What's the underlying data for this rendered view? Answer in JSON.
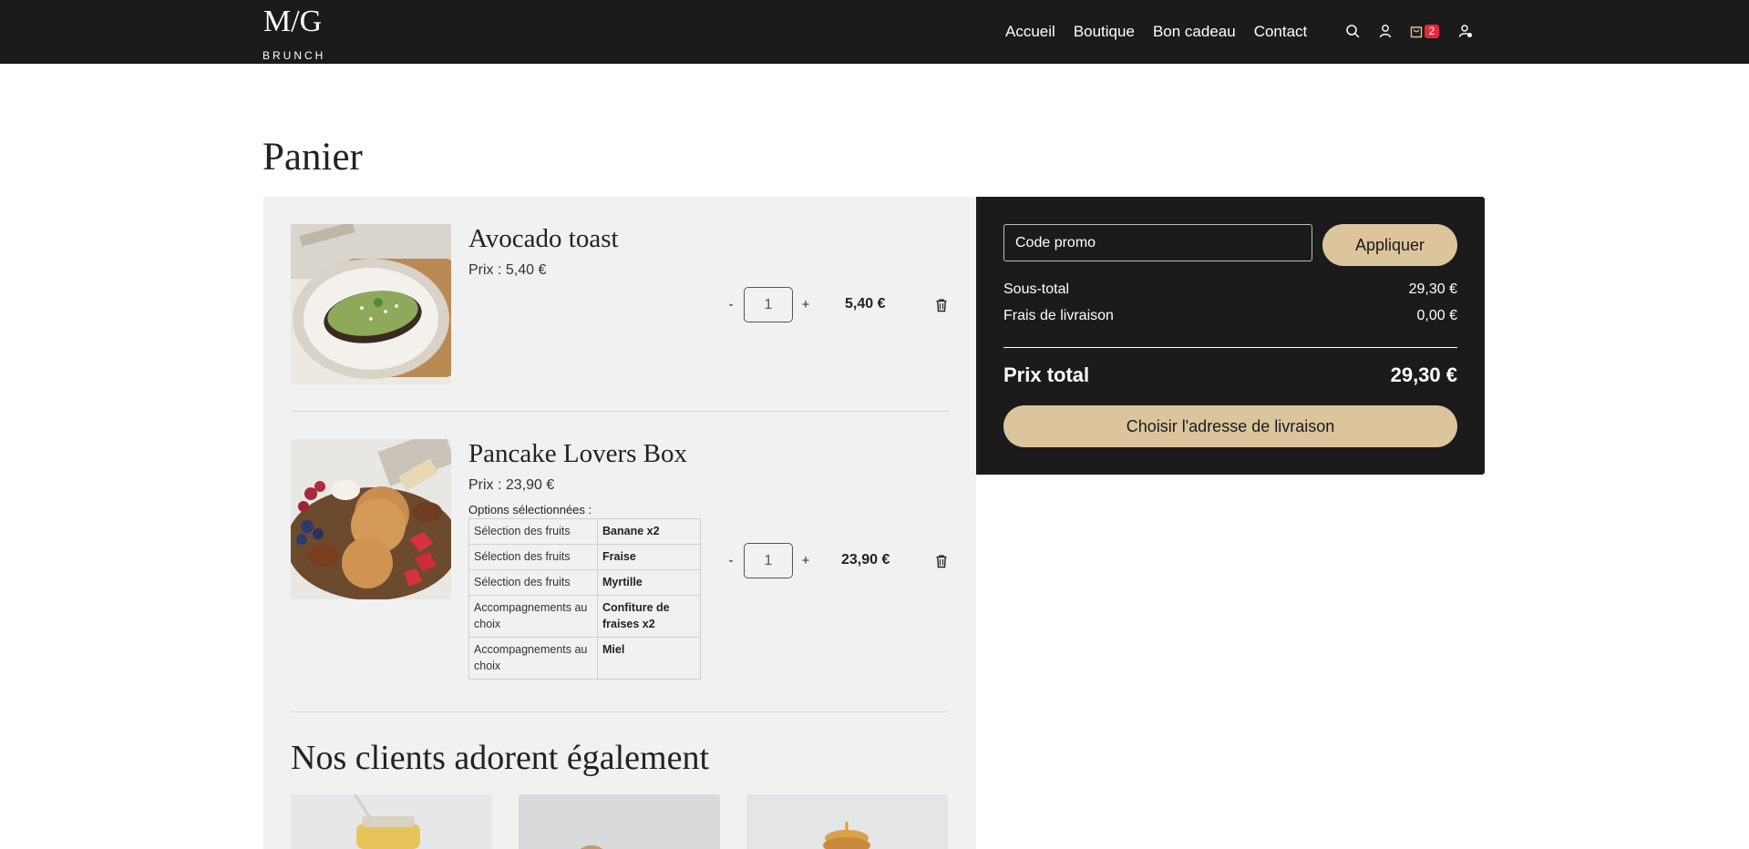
{
  "header": {
    "logo_mark": "M/G",
    "logo_word": "BRUNCH",
    "menu": [
      "Accueil",
      "Boutique",
      "Bon cadeau",
      "Contact"
    ],
    "icons": [
      "search-icon",
      "user-icon",
      "cart-icon",
      "account-icon"
    ],
    "cart_count": "2"
  },
  "page": {
    "title": "Panier"
  },
  "cart": {
    "items": [
      {
        "name": "Avocado toast",
        "price": "Prix : 5,40 €",
        "quantity": "1",
        "minus": "-",
        "plus": "+",
        "total": "5,40 €"
      },
      {
        "name": "Pancake Lovers Box",
        "price": "Prix : 23,90 €",
        "options_label": "Options sélectionnées :",
        "options": [
          {
            "key": "Sélection des fruits",
            "value": "Banane x2"
          },
          {
            "key": "Sélection des fruits",
            "value": "Fraise"
          },
          {
            "key": "Sélection des fruits",
            "value": "Myrtille"
          },
          {
            "key": "Accompagnements au choix",
            "value": "Confiture de fraises x2"
          },
          {
            "key": "Accompagnements au choix",
            "value": "Miel"
          }
        ],
        "quantity": "1",
        "minus": "-",
        "plus": "+",
        "total": "23,90 €"
      }
    ]
  },
  "recommendations": {
    "title": "Nos clients adorent également"
  },
  "summary": {
    "promo_placeholder": "Code promo",
    "apply_label": "Appliquer",
    "subtotal_label": "Sous-total",
    "subtotal_value": "29,30 €",
    "shipping_label": "Frais de livraison",
    "shipping_value": "0,00 €",
    "total_label": "Prix total",
    "total_value": "29,30 €",
    "checkout_label": "Choisir l'adresse de livraison"
  },
  "colors": {
    "nav_bg": "#1b1b1b",
    "accent": "#dcc49d",
    "badge": "#e8263b",
    "panel_bg": "#f1f1f1"
  }
}
